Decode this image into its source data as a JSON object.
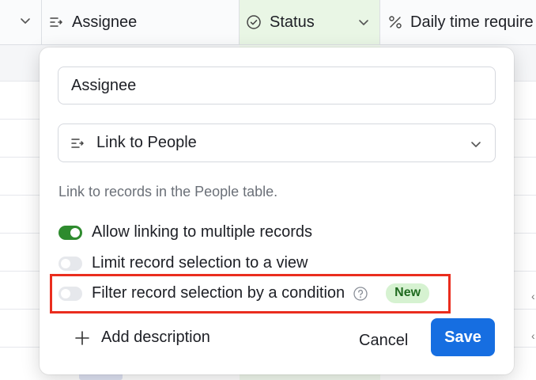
{
  "grid": {
    "columns": [
      {
        "label": "",
        "icon": "chevron-down-icon"
      },
      {
        "label": "Assignee",
        "icon": "link-field-icon"
      },
      {
        "label": "Status",
        "icon": "status-circle-check-icon"
      },
      {
        "label": "Daily time require",
        "icon": "percent-icon"
      }
    ]
  },
  "popover": {
    "field_name_value": "Assignee",
    "field_type": {
      "label": "Link to People",
      "icon": "link-field-icon"
    },
    "description": "Link to records in the People table.",
    "toggles": [
      {
        "label": "Allow linking to multiple records",
        "on": true
      },
      {
        "label": "Limit record selection to a view",
        "on": false
      },
      {
        "label": "Filter record selection by a condition",
        "on": false,
        "badge": "New",
        "help_icon": "question-circle-icon"
      }
    ],
    "add_description_label": "Add description",
    "cancel_label": "Cancel",
    "save_label": "Save"
  },
  "colors": {
    "accent_blue": "#166ee1",
    "toggle_on_green": "#2e8b2e",
    "badge_bg": "#d6f2d1",
    "highlight_red": "#ea2d1e"
  }
}
